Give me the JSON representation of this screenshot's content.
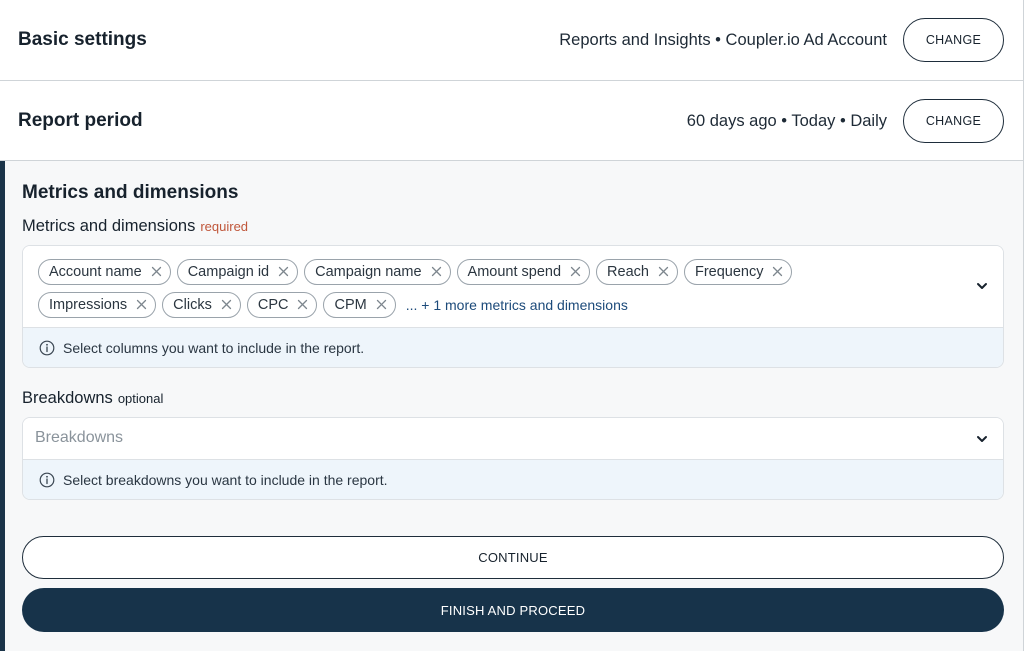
{
  "basic_settings": {
    "title": "Basic settings",
    "summary": "Reports and Insights • Coupler.io Ad Account",
    "change_label": "CHANGE"
  },
  "report_period": {
    "title": "Report period",
    "summary": "60 days ago • Today • Daily",
    "change_label": "CHANGE"
  },
  "metrics_section": {
    "title": "Metrics and dimensions",
    "field_label": "Metrics and dimensions",
    "required_tag": "required",
    "chips_row1": [
      "Account name",
      "Campaign id",
      "Campaign name",
      "Amount spend",
      "Reach",
      "Frequency"
    ],
    "chips_row2": [
      "Impressions",
      "Clicks",
      "CPC",
      "CPM"
    ],
    "more_text": "... + 1 more metrics and dimensions",
    "hint": "Select columns you want to include in the report."
  },
  "breakdowns": {
    "field_label": "Breakdowns",
    "optional_tag": "optional",
    "placeholder": "Breakdowns",
    "hint": "Select breakdowns you want to include in the report."
  },
  "actions": {
    "continue_label": "CONTINUE",
    "finish_label": "FINISH AND PROCEED"
  },
  "icons": {
    "remove": "close-icon",
    "dropdown": "chevron-down-icon",
    "info": "info-icon"
  },
  "colors": {
    "primary_dark": "#17334a",
    "required": "#c0573b",
    "hint_bg": "#eef5fb",
    "link": "#1c4a7a"
  }
}
